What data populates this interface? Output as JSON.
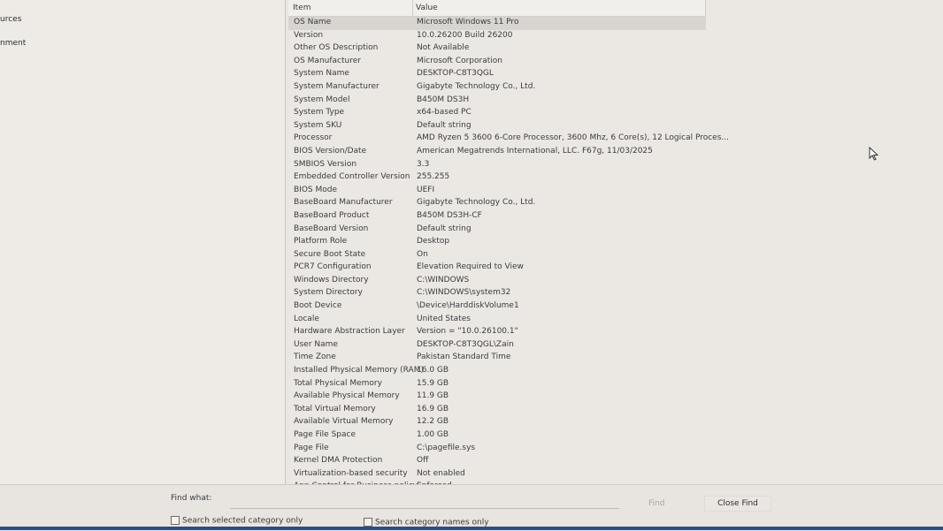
{
  "tree": {
    "items": [
      {
        "label": "urces"
      },
      {
        "label": "nment"
      }
    ]
  },
  "list": {
    "headers": {
      "item": "Item",
      "value": "Value"
    },
    "rows": [
      {
        "item": "OS Name",
        "value": "Microsoft Windows 11 Pro"
      },
      {
        "item": "Version",
        "value": "10.0.26200 Build 26200"
      },
      {
        "item": "Other OS Description",
        "value": "Not Available"
      },
      {
        "item": "OS Manufacturer",
        "value": "Microsoft Corporation"
      },
      {
        "item": "System Name",
        "value": "DESKTOP-C8T3QGL"
      },
      {
        "item": "System Manufacturer",
        "value": "Gigabyte Technology Co., Ltd."
      },
      {
        "item": "System Model",
        "value": "B450M DS3H"
      },
      {
        "item": "System Type",
        "value": "x64-based PC"
      },
      {
        "item": "System SKU",
        "value": "Default string"
      },
      {
        "item": "Processor",
        "value": "AMD Ryzen 5 3600 6-Core Processor, 3600 Mhz, 6 Core(s), 12 Logical Proces..."
      },
      {
        "item": "BIOS Version/Date",
        "value": "American Megatrends International, LLC. F67g, 11/03/2025"
      },
      {
        "item": "SMBIOS Version",
        "value": "3.3"
      },
      {
        "item": "Embedded Controller Version",
        "value": "255.255"
      },
      {
        "item": "BIOS Mode",
        "value": "UEFI"
      },
      {
        "item": "BaseBoard Manufacturer",
        "value": "Gigabyte Technology Co., Ltd."
      },
      {
        "item": "BaseBoard Product",
        "value": "B450M DS3H-CF"
      },
      {
        "item": "BaseBoard Version",
        "value": "Default string"
      },
      {
        "item": "Platform Role",
        "value": "Desktop"
      },
      {
        "item": "Secure Boot State",
        "value": "On"
      },
      {
        "item": "PCR7 Configuration",
        "value": "Elevation Required to View"
      },
      {
        "item": "Windows Directory",
        "value": "C:\\WINDOWS"
      },
      {
        "item": "System Directory",
        "value": "C:\\WINDOWS\\system32"
      },
      {
        "item": "Boot Device",
        "value": "\\Device\\HarddiskVolume1"
      },
      {
        "item": "Locale",
        "value": "United States"
      },
      {
        "item": "Hardware Abstraction Layer",
        "value": "Version = \"10.0.26100.1\""
      },
      {
        "item": "User Name",
        "value": "DESKTOP-C8T3QGL\\Zain"
      },
      {
        "item": "Time Zone",
        "value": "Pakistan Standard Time"
      },
      {
        "item": "Installed Physical Memory (RAM)",
        "value": "16.0 GB"
      },
      {
        "item": "Total Physical Memory",
        "value": "15.9 GB"
      },
      {
        "item": "Available Physical Memory",
        "value": "11.9 GB"
      },
      {
        "item": "Total Virtual Memory",
        "value": "16.9 GB"
      },
      {
        "item": "Available Virtual Memory",
        "value": "12.2 GB"
      },
      {
        "item": "Page File Space",
        "value": "1.00 GB"
      },
      {
        "item": "Page File",
        "value": "C:\\pagefile.sys"
      },
      {
        "item": "Kernel DMA Protection",
        "value": "Off"
      },
      {
        "item": "Virtualization-based security",
        "value": "Not enabled"
      },
      {
        "item": "App Control for Business policy",
        "value": "Enforced"
      }
    ]
  },
  "findbar": {
    "label": "Find what:",
    "input_value": "",
    "find_label": "Find",
    "close_label": "Close Find",
    "check_selected": "Search selected category only",
    "check_names": "Search category names only"
  },
  "colors": {
    "background": "#e9e6e2",
    "selected_row": "#d8d5d1",
    "disabled_text": "#a9a6a2"
  }
}
